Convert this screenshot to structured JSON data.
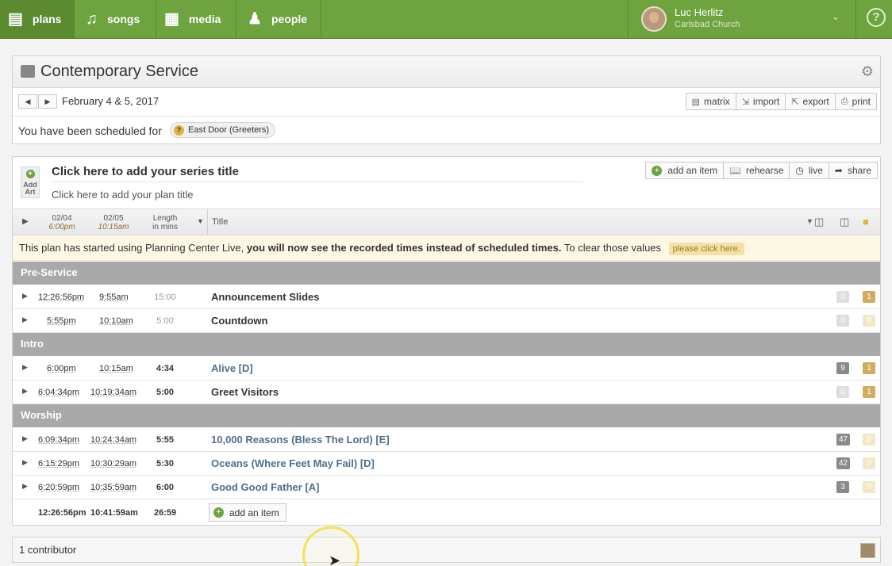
{
  "nav": {
    "tabs": [
      {
        "label": "plans",
        "icon": "clipboard-icon"
      },
      {
        "label": "songs",
        "icon": "music-note-icon"
      },
      {
        "label": "media",
        "icon": "film-icon"
      },
      {
        "label": "people",
        "icon": "people-icon"
      }
    ],
    "user_name": "Luc Herlitz",
    "user_org": "Carlsbad Church",
    "help": "?"
  },
  "header": {
    "title": "Contemporary Service",
    "date": "February 4 & 5, 2017",
    "tools": [
      "matrix",
      "import",
      "export",
      "print"
    ],
    "scheduled_text": "You have been scheduled for",
    "position": "East Door (Greeters)"
  },
  "plan": {
    "add_art": "Add Art",
    "series_title": "Click here to add your series title",
    "plan_title": "Click here to add your plan title",
    "actions": [
      "add an item",
      "rehearse",
      "live",
      "share"
    ],
    "columns": {
      "c1_date": "02/04",
      "c1_time": "6:00pm",
      "c2_date": "02/05",
      "c2_time": "10:15am",
      "length": "Length",
      "length_sub": "in mins",
      "title": "Title"
    },
    "notice": {
      "prefix": "This plan has started using Planning Center Live,",
      "bold": "you will now see the recorded times instead of scheduled times.",
      "suffix": "To clear those values",
      "link": "please click here."
    },
    "sections": [
      {
        "name": "Pre-Service",
        "items": [
          {
            "t1": "12:26:56pm",
            "t2": "9:55am",
            "len": "15:00",
            "title": "Announcement Slides",
            "song": false,
            "files": "0",
            "notes": "1"
          },
          {
            "t1": "5:55pm",
            "t2": "10:10am",
            "len": "5:00",
            "title": "Countdown",
            "song": false,
            "files": "0",
            "notes": "0"
          }
        ]
      },
      {
        "name": "Intro",
        "items": [
          {
            "t1": "6:00pm",
            "t2": "10:15am",
            "len": "4:34",
            "title": "Alive [D]",
            "song": true,
            "files": "9",
            "notes": "1"
          },
          {
            "t1": "6:04:34pm",
            "t2": "10:19:34am",
            "len": "5:00",
            "title": "Greet Visitors",
            "song": false,
            "files": "0",
            "notes": "1"
          }
        ]
      },
      {
        "name": "Worship",
        "items": [
          {
            "t1": "6:09:34pm",
            "t2": "10:24:34am",
            "len": "5:55",
            "title": "10,000 Reasons (Bless The Lord) [E]",
            "song": true,
            "files": "47",
            "notes": "0"
          },
          {
            "t1": "6:15:29pm",
            "t2": "10:30:29am",
            "len": "5:30",
            "title": "Oceans (Where Feet May Fail) [D]",
            "song": true,
            "files": "42",
            "notes": "0"
          },
          {
            "t1": "6:20:59pm",
            "t2": "10:35:59am",
            "len": "6:00",
            "title": "Good Good Father [A]",
            "song": true,
            "files": "3",
            "notes": "0"
          }
        ]
      }
    ],
    "totals": {
      "t1": "12:26:56pm",
      "t2": "10:41:59am",
      "len": "26:59",
      "add": "add an item"
    }
  },
  "footer": {
    "contributors": "1 contributor"
  },
  "colors": {
    "brand": "#6ea33f",
    "section": "#a9a9a9",
    "notice": "#fcf8e3",
    "song_title": "#4d6f8c"
  }
}
